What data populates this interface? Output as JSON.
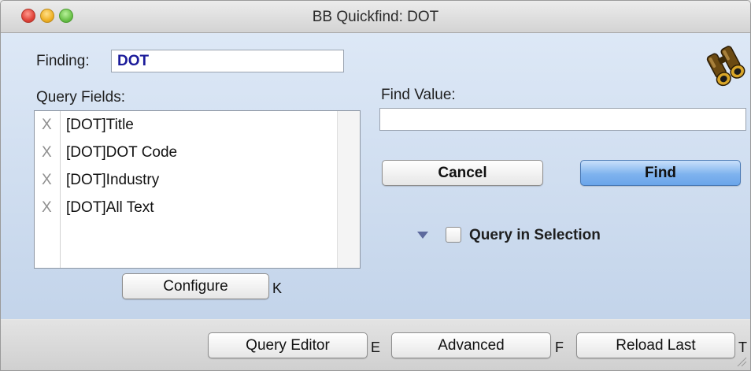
{
  "window": {
    "title": "BB Quickfind: DOT"
  },
  "finding": {
    "label": "Finding:",
    "value": "DOT"
  },
  "query_fields": {
    "label": "Query Fields:",
    "items": [
      {
        "mark": "X",
        "name": "[DOT]Title"
      },
      {
        "mark": "X",
        "name": "[DOT]DOT Code"
      },
      {
        "mark": "X",
        "name": "[DOT]Industry"
      },
      {
        "mark": "X",
        "name": "[DOT]All Text"
      }
    ]
  },
  "find_value": {
    "label": "Find Value:",
    "value": ""
  },
  "buttons": {
    "cancel": "Cancel",
    "find": "Find",
    "configure": "Configure",
    "configure_shortcut": "K",
    "query_editor": "Query Editor",
    "query_editor_shortcut": "E",
    "advanced": "Advanced",
    "advanced_shortcut": "F",
    "reload_last": "Reload Last",
    "reload_last_shortcut": "T"
  },
  "query_in_selection": {
    "label": "Query in Selection",
    "checked": false
  },
  "icons": {
    "binoculars": "binoculars-icon",
    "disclosure": "disclosure-triangle-icon"
  },
  "colors": {
    "finding_text": "#1b1b9a",
    "find_button": "#7fb3ee"
  }
}
